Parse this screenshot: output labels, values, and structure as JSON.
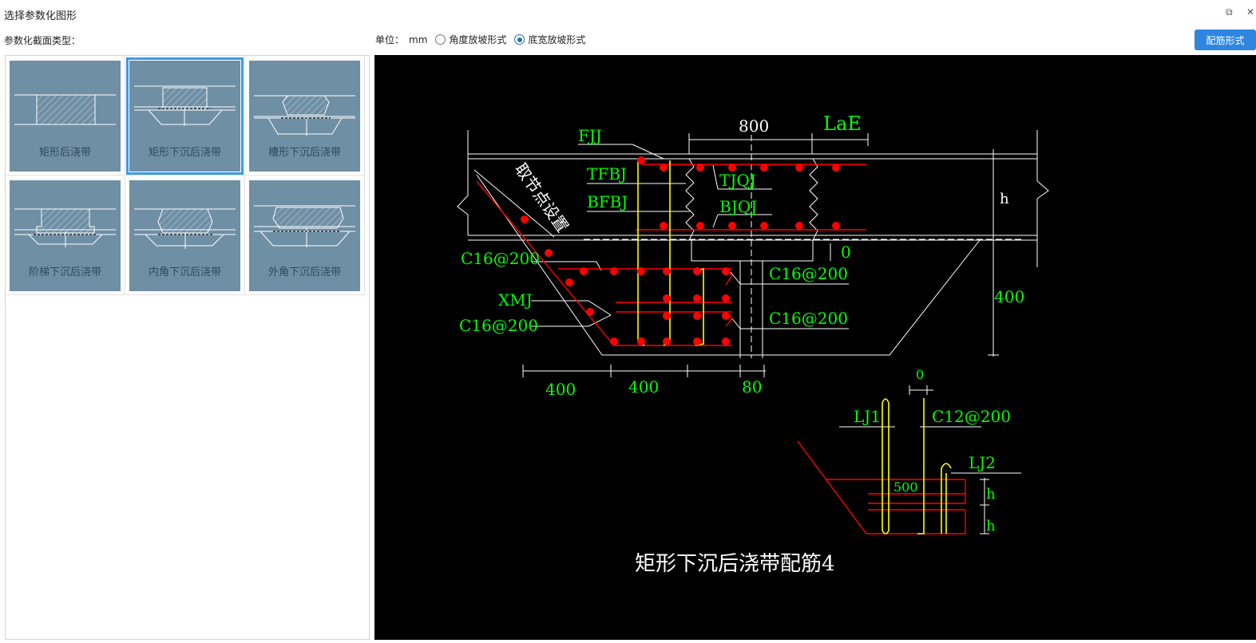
{
  "window": {
    "title": "选择参数化图形",
    "restore_glyph": "⧉",
    "close_glyph": "✕"
  },
  "toolbar": {
    "section_label": "参数化截面类型：",
    "unit_label": "单位：",
    "unit_value": "mm",
    "radio_angle": "角度放坡形式",
    "radio_base": "底宽放坡形式",
    "selected_radio": "radio_base",
    "rebar_button": "配筋形式"
  },
  "shapes": [
    {
      "label": "矩形后浇带",
      "selected": false
    },
    {
      "label": "矩形下沉后浇带",
      "selected": true
    },
    {
      "label": "槽形下沉后浇带",
      "selected": false
    },
    {
      "label": "阶梯下沉后浇带",
      "selected": false
    },
    {
      "label": "内角下沉后浇带",
      "selected": false
    },
    {
      "label": "外角下沉后浇带",
      "selected": false
    }
  ],
  "drawing": {
    "caption": "矩形下沉后浇带配筋4",
    "labels": {
      "fjj": "FJJ",
      "tfbj": "TFBJ",
      "bfbj": "BFBJ",
      "tjqj": "TJQJ",
      "bjqj": "BJQJ",
      "c16_1": "C16@200",
      "xmj": "XMJ",
      "c16_2": "C16@200",
      "c16_3": "C16@200",
      "c16_4": "C16@200",
      "lj1": "LJ1",
      "c12": "C12@200",
      "lj2": "LJ2",
      "node_setting": "取节点设置"
    },
    "dims": {
      "d800": "800",
      "lae": "LaE",
      "h1": "h",
      "zero1": "0",
      "d400v": "400",
      "d400a": "400",
      "d400b": "400",
      "d80": "80",
      "zero2": "0",
      "d500": "500",
      "h2": "h",
      "h3": "h"
    },
    "colors": {
      "rebar": "#ff0000",
      "stirrup": "#ffff00",
      "label": "#00ff00",
      "line": "#ffffff",
      "panel_bg": "#000000",
      "thumb_bg": "#6f8fa5"
    }
  }
}
